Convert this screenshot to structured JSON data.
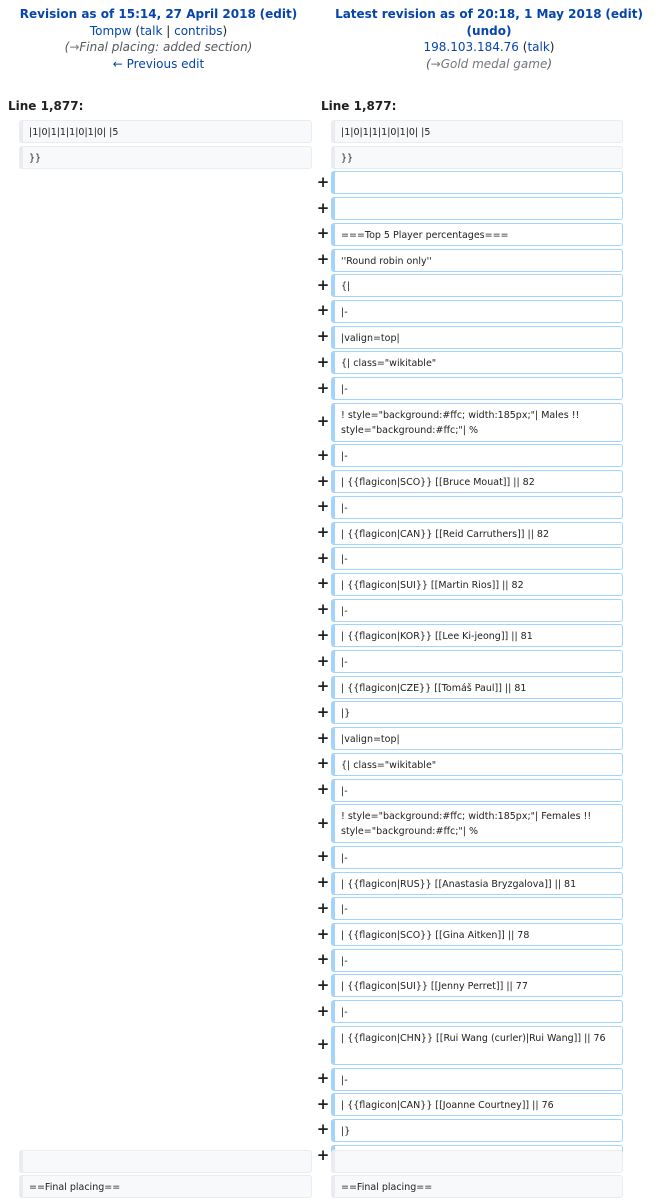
{
  "header": {
    "left": {
      "title_prefix": "Revision as of 15:14, 27 April 2018",
      "edit": "(edit)",
      "user": "Tompw",
      "talk": "talk",
      "contribs": "contribs",
      "summary_arrow": "→",
      "summary_section": "Final placing:",
      "summary_text": " added section",
      "prev_edit": "← Previous edit"
    },
    "right": {
      "title_prefix": "Latest revision as of 20:18, 1 May 2018",
      "edit": "(edit)",
      "undo": "(undo)",
      "user": "198.103.184.76",
      "talk": "talk",
      "summary_arrow": "→",
      "summary_section": "Gold medal game"
    }
  },
  "line_numbers": {
    "left": "Line 1,877:",
    "right": "Line 1,877:"
  },
  "context_top": [
    "|1|0|1|1|1|0|1|0| |5",
    "}}"
  ],
  "added_lines": [
    "",
    "",
    "===Top 5 Player percentages===",
    "''Round robin only''",
    "{|",
    "|-",
    "|valign=top|",
    "{| class=\"wikitable\"",
    "|-",
    "! style=\"background:#ffc; width:185px;\"| Males !! style=\"background:#ffc;\"| %",
    "|-",
    "| {{flagicon|SCO}} [[Bruce Mouat]] || 82",
    "|-",
    "| {{flagicon|CAN}} [[Reid Carruthers]] || 82",
    "|-",
    "| {{flagicon|SUI}} [[Martin Rios]] || 82",
    "|-",
    "| {{flagicon|KOR}} [[Lee Ki-jeong]] || 81",
    "|-",
    "| {{flagicon|CZE}} [[Tomáš Paul]] || 81",
    "|}",
    "|valign=top|",
    "{| class=\"wikitable\"",
    "|-",
    "! style=\"background:#ffc; width:185px;\"| Females !! style=\"background:#ffc;\"| %",
    "|-",
    "| {{flagicon|RUS}} [[Anastasia Bryzgalova]] || 81",
    "|-",
    "| {{flagicon|SCO}} [[Gina Aitken]] || 78",
    "|-",
    "| {{flagicon|SUI}} [[Jenny Perret]] || 77",
    "|-",
    "| {{flagicon|CHN}} [[Rui Wang (curler)|Rui Wang]] || 76",
    "|-",
    "| {{flagicon|CAN}} [[Joanne Courtney]] || 76",
    "|}",
    "|}"
  ],
  "plus_symbol": "+",
  "context_bottom": [
    "",
    "==Final placing=="
  ],
  "colors": {
    "link": "#0645ad",
    "context_bg": "#f8f9fa",
    "context_border": "#eaecf0",
    "added_border": "#a3d3ff"
  }
}
